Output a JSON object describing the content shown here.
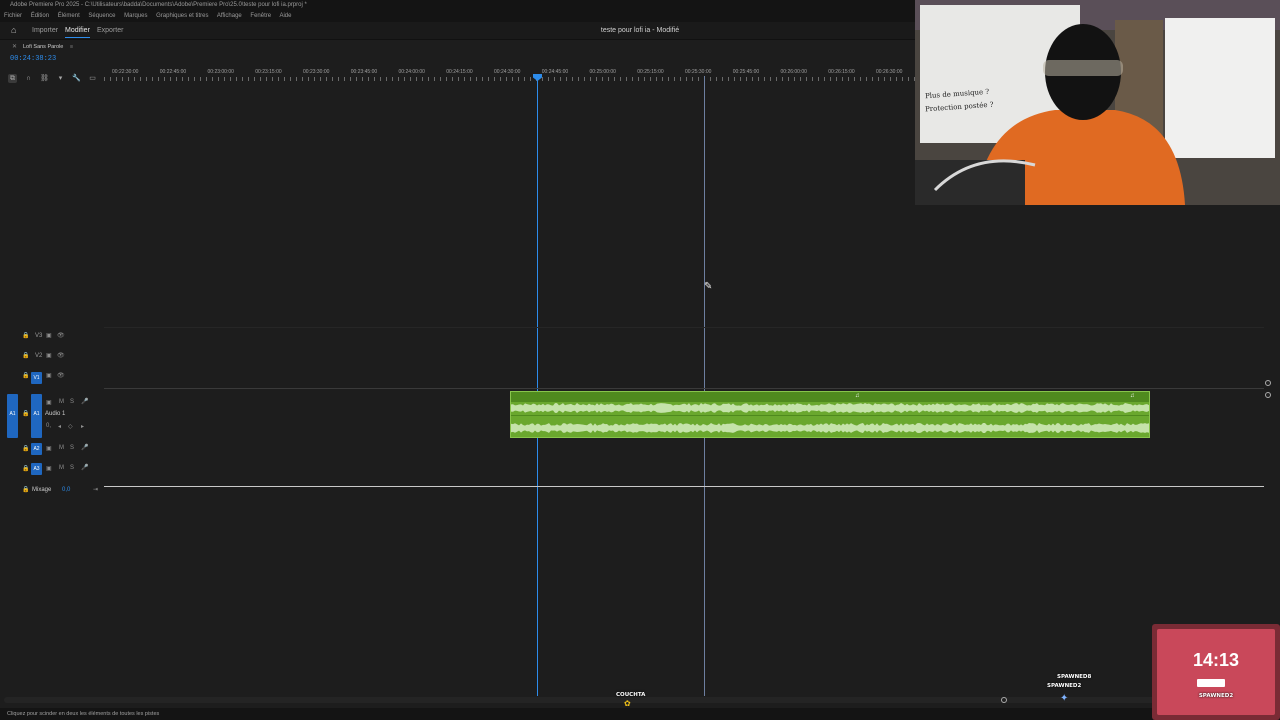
{
  "window": {
    "title": "Adobe Premiere Pro 2025 - C:\\Utilisateurs\\badda\\Documents\\Adobe\\Premiere Pro\\25.0\\teste pour lofi ia.prproj *"
  },
  "menu": [
    "Fichier",
    "Édition",
    "Élément",
    "Séquence",
    "Marques",
    "Graphiques et titres",
    "Affichage",
    "Fenêtre",
    "Aide"
  ],
  "appbar": {
    "tabs": [
      "Importer",
      "Modifier",
      "Exporter"
    ],
    "active_tab": "Modifier",
    "document_title": "teste pour lofi ia - Modifié"
  },
  "sequence": {
    "name": "Lofi Sans Parole",
    "timecode": "00:24:38:23"
  },
  "ruler": {
    "labels": [
      "00:22:30:00",
      "00:22:45:00",
      "00:23:00:00",
      "00:23:15:00",
      "00:23:30:00",
      "00:23:45:00",
      "00:24:00:00",
      "00:24:15:00",
      "00:24:30:00",
      "00:24:45:00",
      "00:25:00:00",
      "00:25:15:00",
      "00:25:30:00",
      "00:25:45:00",
      "00:26:00:00",
      "00:26:15:00",
      "00:26:30:00"
    ]
  },
  "tracks": {
    "video": [
      {
        "id": "V3",
        "label": "V3"
      },
      {
        "id": "V2",
        "label": "V2"
      },
      {
        "id": "V1",
        "label": "V1"
      }
    ],
    "audio": [
      {
        "id": "A1",
        "label": "A1",
        "name": "Audio 1",
        "volume": "0,"
      },
      {
        "id": "A2",
        "label": "A2"
      },
      {
        "id": "A3",
        "label": "A3"
      }
    ],
    "mix": {
      "label": "Mixage",
      "value": "0,0"
    },
    "mute": "M",
    "solo": "S"
  },
  "status": {
    "text": "Cliquez pour scinder en deux les éléments de toutes les pistes"
  },
  "overlays": {
    "clock": "14:13",
    "clock_caption": "SPAWNED2",
    "names": [
      "COUCHTA",
      "SPAWNED8",
      "SPAWNED2"
    ],
    "whiteboard_lines": [
      "Plus de musique ?",
      "Protection postée ?"
    ]
  },
  "colors": {
    "accent": "#2d8ceb",
    "clip": "#6aa82e",
    "clip_wave": "#d4ecc0",
    "track_badge": "#1f67c0"
  }
}
